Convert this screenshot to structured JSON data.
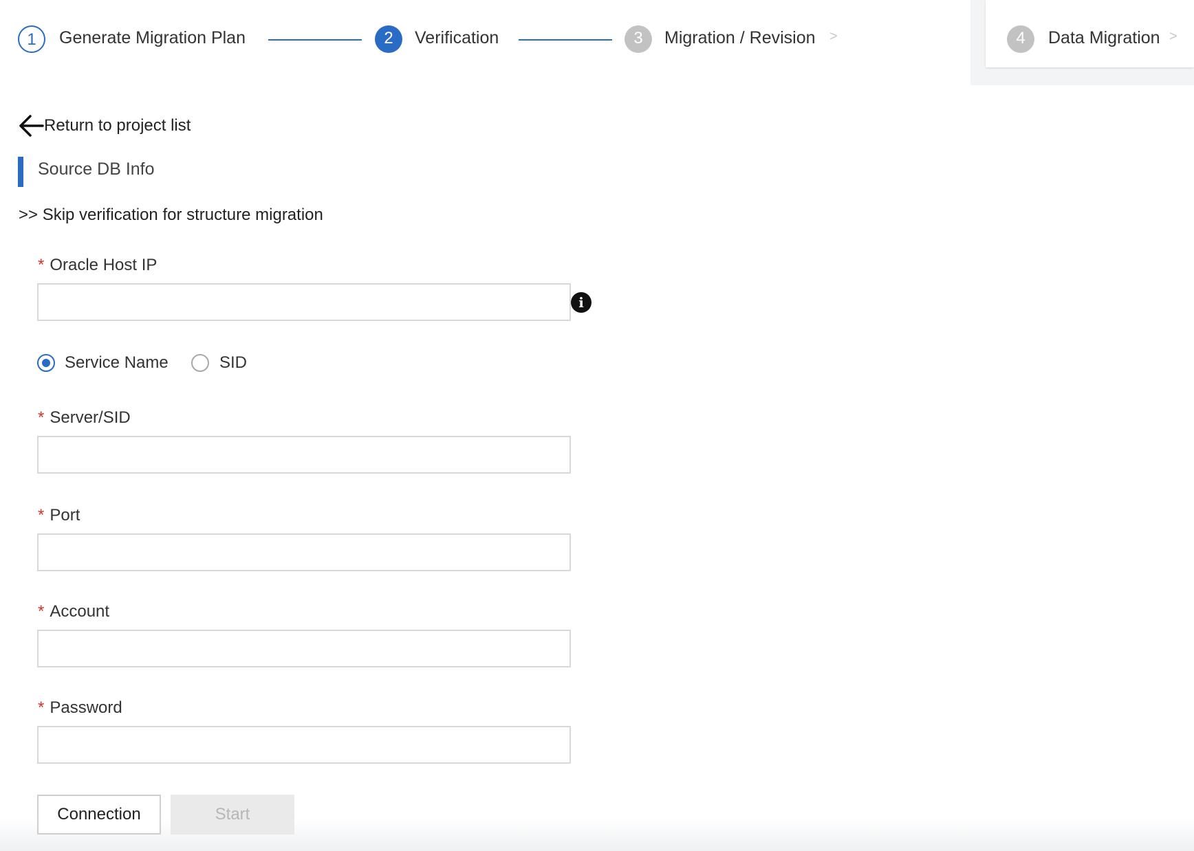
{
  "stepper": {
    "steps": [
      {
        "number": "1",
        "label": "Generate Migration Plan",
        "state": "completed"
      },
      {
        "number": "2",
        "label": "Verification",
        "state": "active"
      },
      {
        "number": "3",
        "label": "Migration / Revision",
        "state": "pending"
      },
      {
        "number": "4",
        "label": "Data Migration",
        "state": "pending"
      }
    ],
    "caret": ">"
  },
  "nav": {
    "back_label": "Return to project list",
    "back_icon": "arrow-left-icon"
  },
  "section": {
    "title": "Source DB Info"
  },
  "skip_link": ">> Skip verification for structure migration",
  "form": {
    "required_marker": "*",
    "oracle_host_ip": {
      "label": "Oracle Host IP",
      "value": "",
      "info_icon": "info-icon",
      "info_glyph": "i"
    },
    "connect_type": {
      "options": [
        {
          "label": "Service Name",
          "selected": true
        },
        {
          "label": "SID",
          "selected": false
        }
      ]
    },
    "server_sid": {
      "label": "Server/SID",
      "value": ""
    },
    "port": {
      "label": "Port",
      "value": ""
    },
    "account": {
      "label": "Account",
      "value": ""
    },
    "password": {
      "label": "Password",
      "value": ""
    }
  },
  "actions": {
    "connection_label": "Connection",
    "start_label": "Start",
    "start_disabled": true
  },
  "colors": {
    "accent": "#2a6cc4",
    "required": "#d9342b",
    "inactive_step": "#c2c2c2",
    "border": "#d8d8d8"
  }
}
